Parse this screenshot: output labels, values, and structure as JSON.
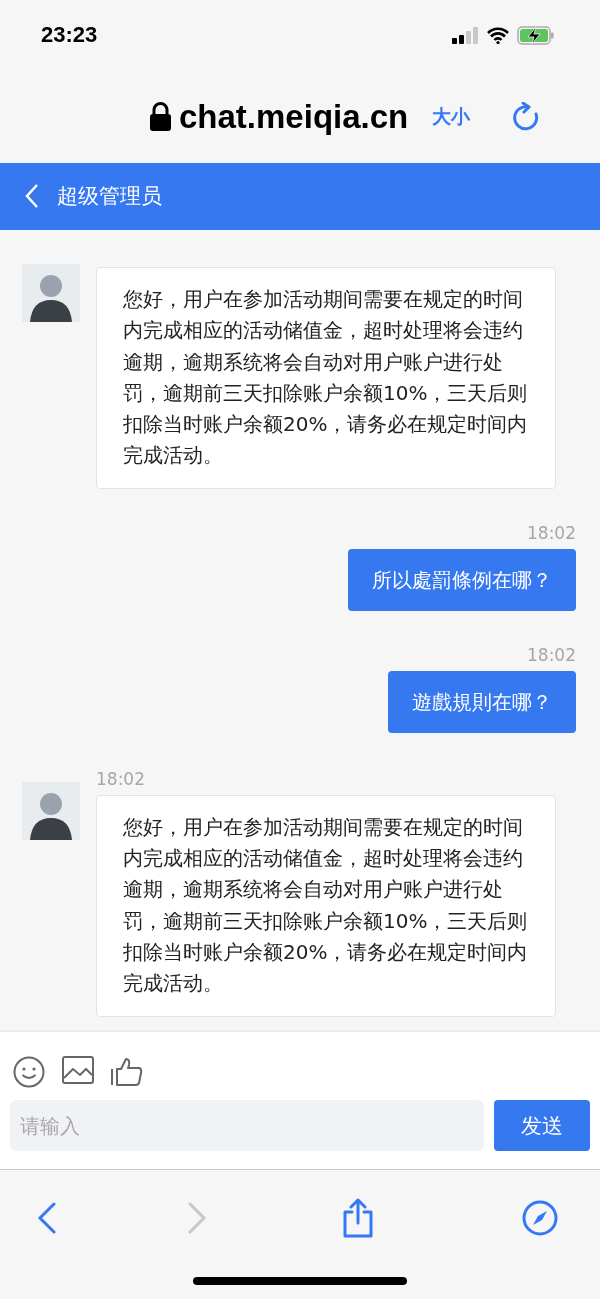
{
  "status_bar": {
    "time": "23:23"
  },
  "browser": {
    "url": "chat.meiqia.cn",
    "text_size": "大小"
  },
  "header": {
    "title": "超级管理员"
  },
  "messages": [
    {
      "kind": "agent",
      "text": "您好，用户在参加活动期间需要在规定的时间内完成相应的活动储值金，超时处理将会违约逾期，逾期系统将会自动对用户账户进行处罚，逾期前三天扣除账户余额10%，三天后则扣除当时账户余额20%，请务必在规定时间内完成活动。"
    },
    {
      "kind": "user",
      "time": "18:02",
      "text": "所以處罰條例在哪？"
    },
    {
      "kind": "user",
      "time": "18:02",
      "text": "遊戲規則在哪？"
    },
    {
      "kind": "agent",
      "time": "18:02",
      "text": "您好，用户在参加活动期间需要在规定的时间内完成相应的活动储值金，超时处理将会违约逾期，逾期系统将会自动对用户账户进行处罚，逾期前三天扣除账户余额10%，三天后则扣除当时账户余额20%，请务必在规定时间内完成活动。"
    }
  ],
  "composer": {
    "placeholder": "请输入",
    "send": "发送"
  },
  "toolbar": {
    "forward_disabled": true
  }
}
